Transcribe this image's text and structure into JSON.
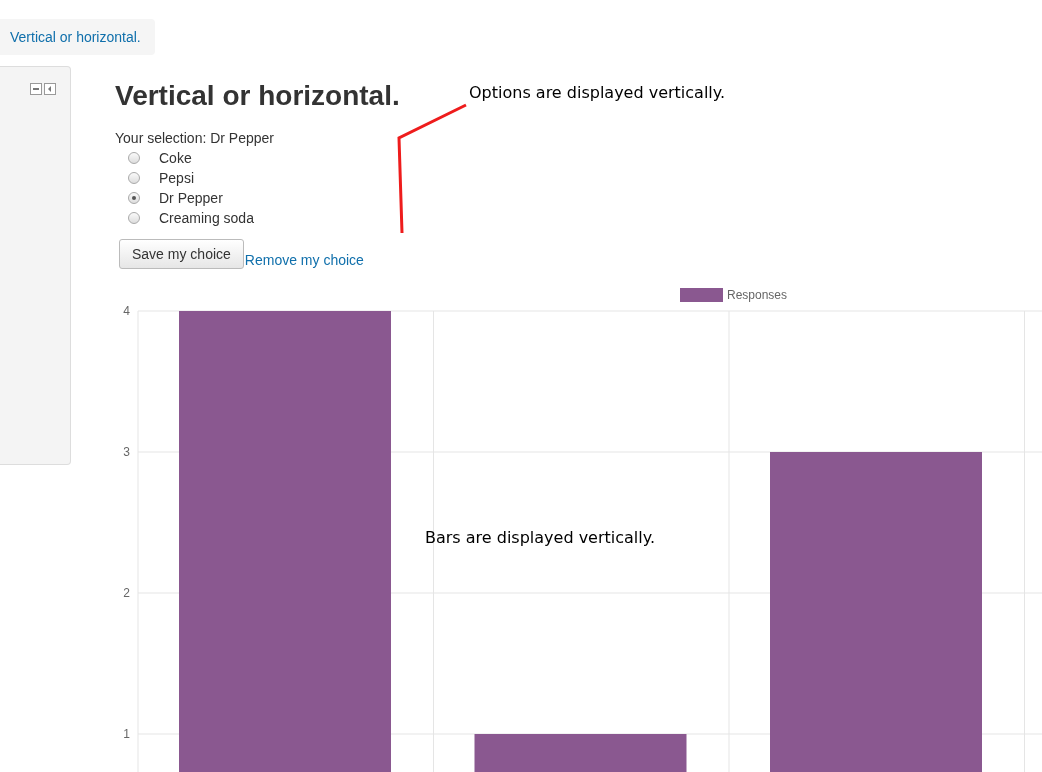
{
  "breadcrumb": {
    "label": "Vertical or horizontal."
  },
  "heading": "Vertical or horizontal.",
  "selection_text": "Your selection: Dr Pepper",
  "options": [
    {
      "label": "Coke",
      "selected": false
    },
    {
      "label": "Pepsi",
      "selected": false
    },
    {
      "label": "Dr Pepper",
      "selected": true
    },
    {
      "label": "Creaming soda",
      "selected": false
    }
  ],
  "save_button": "Save my choice",
  "remove_link": "Remove my choice",
  "chart": {
    "chart_data": {
      "type": "bar",
      "orientation": "vertical",
      "grid": true,
      "ylim": [
        0.72,
        4
      ],
      "yticks": [
        1,
        2,
        3,
        4
      ],
      "series": [
        {
          "name": "Responses",
          "color": "#8a5890",
          "values": [
            4,
            1,
            3
          ]
        }
      ]
    }
  },
  "annotations": [
    "Options are displayed vertically.",
    "Bars are displayed vertically."
  ]
}
